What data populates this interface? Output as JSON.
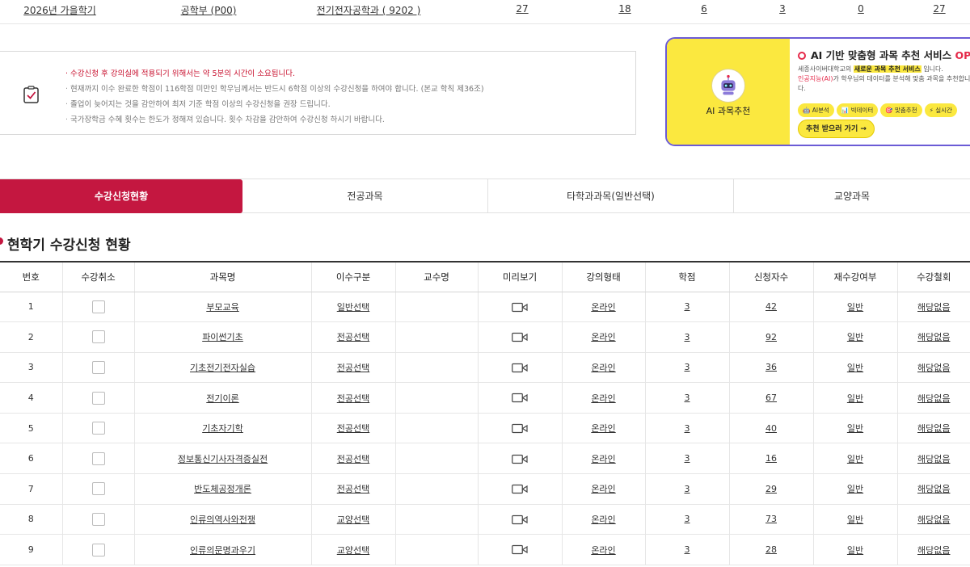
{
  "top_row": {
    "semester": "2026년 가을학기",
    "college": "공학부 (P00)",
    "department": "전기전자공학과 ( 9202 )",
    "n1": "27",
    "n2": "18",
    "n3": "6",
    "n4": "3",
    "n5": "0",
    "n6": "27"
  },
  "notice": {
    "icon": "checklist-icon",
    "lines": [
      "수강신청 후 강의실에 적용되기 위해서는 약 5분의 시간이 소요됩니다.",
      "현재까지 이수 완료한 학점이 116학점 미만인 학우님께서는 반드시 6학점 이상의 수강신청을 하여야 합니다. (본교 학칙 제36조)",
      "졸업이 늦어지는 것을 감안하여 최저 기준 학점 이상의 수강신청을 권장 드립니다.",
      "국가장학금 수혜 횟수는 한도가 정해져 있습니다. 횟수 차감을 감안하여 수강신청 하시기 바랍니다."
    ]
  },
  "ai_banner": {
    "left_label": "AI 과목추천",
    "title": "AI 기반 맞춤형 과목 추천 서비스",
    "title_badge": "OPEN",
    "desc_prefix": "세종사이버대학교의",
    "desc_highlight": "새로운 과목 추천 서비스",
    "desc_mid": "입니다.",
    "desc_red": "인공지능(AI)",
    "desc_suffix": "가 학우님의 데이터를 분석해 맞춤 과목을 추천합니다.",
    "chips": [
      "AI분석",
      "빅데이터",
      "맞춤추천",
      "실시간"
    ],
    "button": "추천 받으러 가기 →",
    "close": "×"
  },
  "tabs": [
    {
      "label": "수강신청현황",
      "active": true
    },
    {
      "label": "전공과목",
      "active": false
    },
    {
      "label": "타학과과목(일반선택)",
      "active": false
    },
    {
      "label": "교양과목",
      "active": false
    }
  ],
  "section": {
    "title": "현학기 수강신청 현황"
  },
  "table": {
    "headers": [
      "번호",
      "수강취소",
      "과목명",
      "이수구분",
      "교수명",
      "미리보기",
      "강의형태",
      "학점",
      "신청자수",
      "재수강여부",
      "수강철회"
    ],
    "rows": [
      {
        "no": "1",
        "name": "부모교육",
        "type": "일반선택",
        "prof": "",
        "form": "온라인",
        "credit": "3",
        "count": "42",
        "retake": "일반",
        "withdraw": "해당없음"
      },
      {
        "no": "2",
        "name": "파이썬기초",
        "type": "전공선택",
        "prof": "",
        "form": "온라인",
        "credit": "3",
        "count": "92",
        "retake": "일반",
        "withdraw": "해당없음"
      },
      {
        "no": "3",
        "name": "기초전기전자실습",
        "type": "전공선택",
        "prof": "",
        "form": "온라인",
        "credit": "3",
        "count": "36",
        "retake": "일반",
        "withdraw": "해당없음"
      },
      {
        "no": "4",
        "name": "전기이론",
        "type": "전공선택",
        "prof": "",
        "form": "온라인",
        "credit": "3",
        "count": "67",
        "retake": "일반",
        "withdraw": "해당없음"
      },
      {
        "no": "5",
        "name": "기초자기학",
        "type": "전공선택",
        "prof": "",
        "form": "온라인",
        "credit": "3",
        "count": "40",
        "retake": "일반",
        "withdraw": "해당없음"
      },
      {
        "no": "6",
        "name": "정보통신기사자격증실전",
        "type": "전공선택",
        "prof": "",
        "form": "온라인",
        "credit": "3",
        "count": "16",
        "retake": "일반",
        "withdraw": "해당없음"
      },
      {
        "no": "7",
        "name": "반도체공정개론",
        "type": "전공선택",
        "prof": "",
        "form": "온라인",
        "credit": "3",
        "count": "29",
        "retake": "일반",
        "withdraw": "해당없음"
      },
      {
        "no": "8",
        "name": "인류의역사와전쟁",
        "type": "교양선택",
        "prof": "",
        "form": "온라인",
        "credit": "3",
        "count": "73",
        "retake": "일반",
        "withdraw": "해당없음"
      },
      {
        "no": "9",
        "name": "인류의문명과우기",
        "type": "교양선택",
        "prof": "",
        "form": "온라인",
        "credit": "3",
        "count": "28",
        "retake": "일반",
        "withdraw": "해당없음"
      }
    ]
  },
  "colors": {
    "accent": "#c41740",
    "ai_yellow": "#fbe83f",
    "ai_border": "#6b5bd6",
    "notice_red": "#c8102e"
  }
}
